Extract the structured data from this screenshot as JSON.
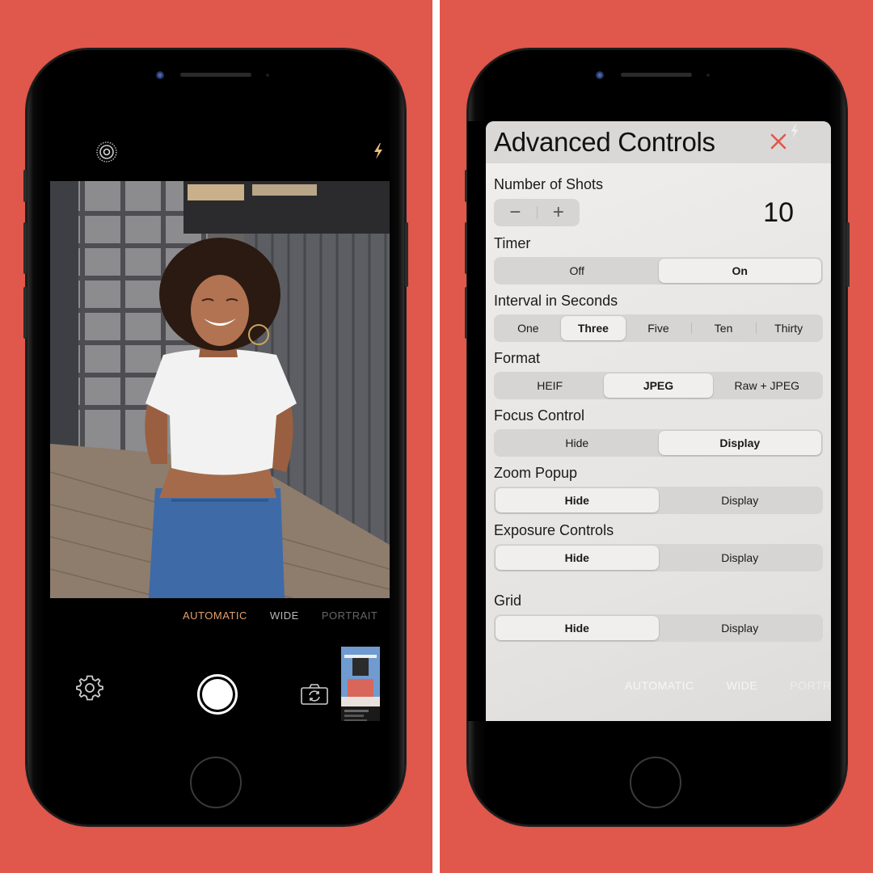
{
  "colors": {
    "background": "#e0574b",
    "mode_active": "#e0a070",
    "close_icon": "#e0574b",
    "flash_icon": "#e8c07a"
  },
  "left_phone": {
    "top_icons": {
      "left": "live-photo-icon",
      "right": "flash-icon"
    },
    "photo": {
      "description": "Smiling woman with curly hair in white t-shirt and jeans standing before gray industrial gate"
    },
    "modes": [
      {
        "label": "AUTOMATIC",
        "active": true
      },
      {
        "label": "WIDE",
        "active": false
      },
      {
        "label": "PORTRAIT",
        "active": false
      }
    ],
    "bottom": {
      "settings_icon": "gear-icon",
      "shutter": "shutter-button",
      "flip_camera_icon": "camera-flip-icon",
      "thumbnail": "last-photo-thumbnail"
    }
  },
  "right_phone": {
    "panel": {
      "title": "Advanced Controls",
      "close_icon": "close-icon",
      "number_of_shots": {
        "label": "Number of Shots",
        "minus": "−",
        "plus": "+",
        "value": "10"
      },
      "timer": {
        "label": "Timer",
        "options": [
          "Off",
          "On"
        ],
        "selected": "On"
      },
      "interval": {
        "label": "Interval in Seconds",
        "options": [
          "One",
          "Three",
          "Five",
          "Ten",
          "Thirty"
        ],
        "selected": "Three"
      },
      "format": {
        "label": "Format",
        "options": [
          "HEIF",
          "JPEG",
          "Raw + JPEG"
        ],
        "selected": "JPEG"
      },
      "focus_control": {
        "label": "Focus Control",
        "options": [
          "Hide",
          "Display"
        ],
        "selected": "Display"
      },
      "zoom_popup": {
        "label": "Zoom Popup",
        "options": [
          "Hide",
          "Display"
        ],
        "selected": "Hide"
      },
      "exposure_controls": {
        "label": "Exposure Controls",
        "options": [
          "Hide",
          "Display"
        ],
        "selected": "Hide"
      },
      "grid": {
        "label": "Grid",
        "options": [
          "Hide",
          "Display"
        ],
        "selected": "Hide"
      }
    },
    "ghost_modes": [
      "AUTOMATIC",
      "WIDE",
      "PORTRAIT"
    ]
  }
}
